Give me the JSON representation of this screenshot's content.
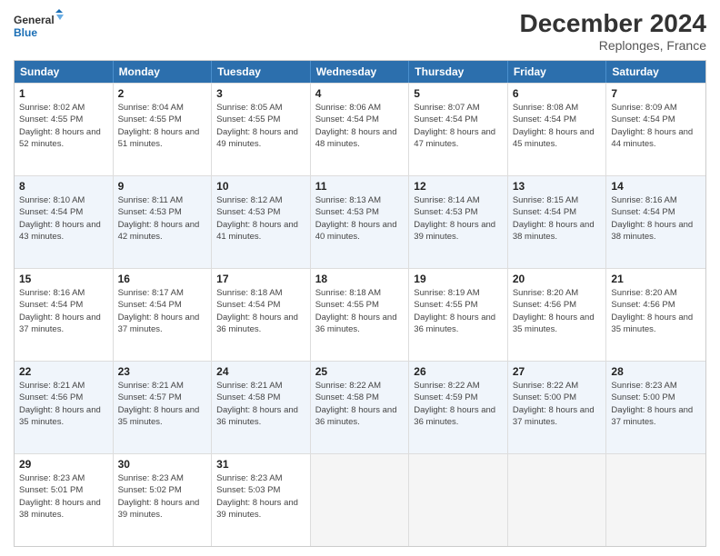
{
  "header": {
    "logo_general": "General",
    "logo_blue": "Blue",
    "main_title": "December 2024",
    "subtitle": "Replonges, France"
  },
  "calendar": {
    "weekdays": [
      "Sunday",
      "Monday",
      "Tuesday",
      "Wednesday",
      "Thursday",
      "Friday",
      "Saturday"
    ],
    "rows": [
      [
        {
          "day": "1",
          "sunrise": "Sunrise: 8:02 AM",
          "sunset": "Sunset: 4:55 PM",
          "daylight": "Daylight: 8 hours and 52 minutes."
        },
        {
          "day": "2",
          "sunrise": "Sunrise: 8:04 AM",
          "sunset": "Sunset: 4:55 PM",
          "daylight": "Daylight: 8 hours and 51 minutes."
        },
        {
          "day": "3",
          "sunrise": "Sunrise: 8:05 AM",
          "sunset": "Sunset: 4:55 PM",
          "daylight": "Daylight: 8 hours and 49 minutes."
        },
        {
          "day": "4",
          "sunrise": "Sunrise: 8:06 AM",
          "sunset": "Sunset: 4:54 PM",
          "daylight": "Daylight: 8 hours and 48 minutes."
        },
        {
          "day": "5",
          "sunrise": "Sunrise: 8:07 AM",
          "sunset": "Sunset: 4:54 PM",
          "daylight": "Daylight: 8 hours and 47 minutes."
        },
        {
          "day": "6",
          "sunrise": "Sunrise: 8:08 AM",
          "sunset": "Sunset: 4:54 PM",
          "daylight": "Daylight: 8 hours and 45 minutes."
        },
        {
          "day": "7",
          "sunrise": "Sunrise: 8:09 AM",
          "sunset": "Sunset: 4:54 PM",
          "daylight": "Daylight: 8 hours and 44 minutes."
        }
      ],
      [
        {
          "day": "8",
          "sunrise": "Sunrise: 8:10 AM",
          "sunset": "Sunset: 4:54 PM",
          "daylight": "Daylight: 8 hours and 43 minutes."
        },
        {
          "day": "9",
          "sunrise": "Sunrise: 8:11 AM",
          "sunset": "Sunset: 4:53 PM",
          "daylight": "Daylight: 8 hours and 42 minutes."
        },
        {
          "day": "10",
          "sunrise": "Sunrise: 8:12 AM",
          "sunset": "Sunset: 4:53 PM",
          "daylight": "Daylight: 8 hours and 41 minutes."
        },
        {
          "day": "11",
          "sunrise": "Sunrise: 8:13 AM",
          "sunset": "Sunset: 4:53 PM",
          "daylight": "Daylight: 8 hours and 40 minutes."
        },
        {
          "day": "12",
          "sunrise": "Sunrise: 8:14 AM",
          "sunset": "Sunset: 4:53 PM",
          "daylight": "Daylight: 8 hours and 39 minutes."
        },
        {
          "day": "13",
          "sunrise": "Sunrise: 8:15 AM",
          "sunset": "Sunset: 4:54 PM",
          "daylight": "Daylight: 8 hours and 38 minutes."
        },
        {
          "day": "14",
          "sunrise": "Sunrise: 8:16 AM",
          "sunset": "Sunset: 4:54 PM",
          "daylight": "Daylight: 8 hours and 38 minutes."
        }
      ],
      [
        {
          "day": "15",
          "sunrise": "Sunrise: 8:16 AM",
          "sunset": "Sunset: 4:54 PM",
          "daylight": "Daylight: 8 hours and 37 minutes."
        },
        {
          "day": "16",
          "sunrise": "Sunrise: 8:17 AM",
          "sunset": "Sunset: 4:54 PM",
          "daylight": "Daylight: 8 hours and 37 minutes."
        },
        {
          "day": "17",
          "sunrise": "Sunrise: 8:18 AM",
          "sunset": "Sunset: 4:54 PM",
          "daylight": "Daylight: 8 hours and 36 minutes."
        },
        {
          "day": "18",
          "sunrise": "Sunrise: 8:18 AM",
          "sunset": "Sunset: 4:55 PM",
          "daylight": "Daylight: 8 hours and 36 minutes."
        },
        {
          "day": "19",
          "sunrise": "Sunrise: 8:19 AM",
          "sunset": "Sunset: 4:55 PM",
          "daylight": "Daylight: 8 hours and 36 minutes."
        },
        {
          "day": "20",
          "sunrise": "Sunrise: 8:20 AM",
          "sunset": "Sunset: 4:56 PM",
          "daylight": "Daylight: 8 hours and 35 minutes."
        },
        {
          "day": "21",
          "sunrise": "Sunrise: 8:20 AM",
          "sunset": "Sunset: 4:56 PM",
          "daylight": "Daylight: 8 hours and 35 minutes."
        }
      ],
      [
        {
          "day": "22",
          "sunrise": "Sunrise: 8:21 AM",
          "sunset": "Sunset: 4:56 PM",
          "daylight": "Daylight: 8 hours and 35 minutes."
        },
        {
          "day": "23",
          "sunrise": "Sunrise: 8:21 AM",
          "sunset": "Sunset: 4:57 PM",
          "daylight": "Daylight: 8 hours and 35 minutes."
        },
        {
          "day": "24",
          "sunrise": "Sunrise: 8:21 AM",
          "sunset": "Sunset: 4:58 PM",
          "daylight": "Daylight: 8 hours and 36 minutes."
        },
        {
          "day": "25",
          "sunrise": "Sunrise: 8:22 AM",
          "sunset": "Sunset: 4:58 PM",
          "daylight": "Daylight: 8 hours and 36 minutes."
        },
        {
          "day": "26",
          "sunrise": "Sunrise: 8:22 AM",
          "sunset": "Sunset: 4:59 PM",
          "daylight": "Daylight: 8 hours and 36 minutes."
        },
        {
          "day": "27",
          "sunrise": "Sunrise: 8:22 AM",
          "sunset": "Sunset: 5:00 PM",
          "daylight": "Daylight: 8 hours and 37 minutes."
        },
        {
          "day": "28",
          "sunrise": "Sunrise: 8:23 AM",
          "sunset": "Sunset: 5:00 PM",
          "daylight": "Daylight: 8 hours and 37 minutes."
        }
      ],
      [
        {
          "day": "29",
          "sunrise": "Sunrise: 8:23 AM",
          "sunset": "Sunset: 5:01 PM",
          "daylight": "Daylight: 8 hours and 38 minutes."
        },
        {
          "day": "30",
          "sunrise": "Sunrise: 8:23 AM",
          "sunset": "Sunset: 5:02 PM",
          "daylight": "Daylight: 8 hours and 39 minutes."
        },
        {
          "day": "31",
          "sunrise": "Sunrise: 8:23 AM",
          "sunset": "Sunset: 5:03 PM",
          "daylight": "Daylight: 8 hours and 39 minutes."
        },
        null,
        null,
        null,
        null
      ]
    ]
  }
}
